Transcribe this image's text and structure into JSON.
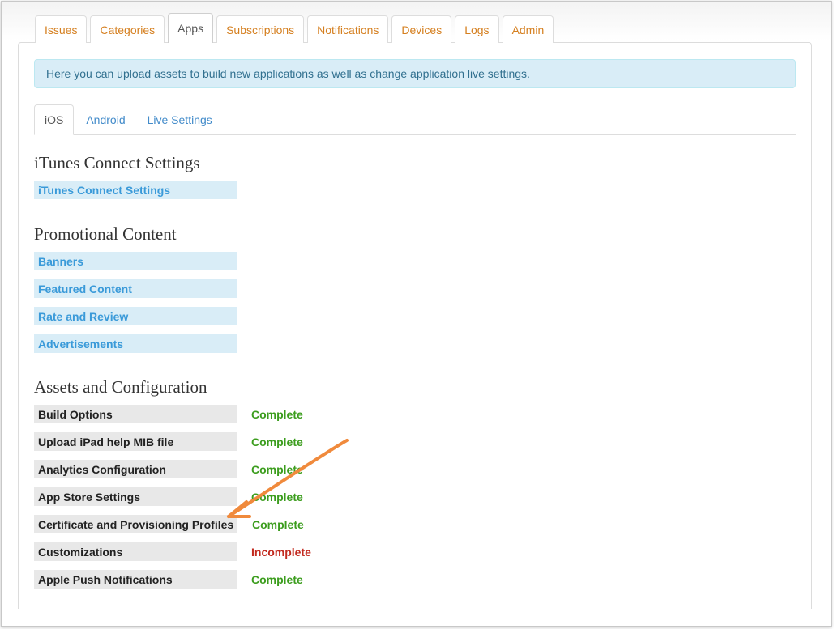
{
  "main_tabs": [
    {
      "label": "Issues",
      "active": false
    },
    {
      "label": "Categories",
      "active": false
    },
    {
      "label": "Apps",
      "active": true
    },
    {
      "label": "Subscriptions",
      "active": false
    },
    {
      "label": "Notifications",
      "active": false
    },
    {
      "label": "Devices",
      "active": false
    },
    {
      "label": "Logs",
      "active": false
    },
    {
      "label": "Admin",
      "active": false
    }
  ],
  "alert": {
    "text": "Here you can upload assets to build new applications as well as change application live settings."
  },
  "sub_tabs": [
    {
      "label": "iOS",
      "active": true
    },
    {
      "label": "Android",
      "active": false
    },
    {
      "label": "Live Settings",
      "active": false
    }
  ],
  "itunes": {
    "heading": "iTunes Connect Settings",
    "items": [
      {
        "label": "iTunes Connect Settings"
      }
    ]
  },
  "promo": {
    "heading": "Promotional Content",
    "items": [
      {
        "label": "Banners"
      },
      {
        "label": "Featured Content"
      },
      {
        "label": "Rate and Review"
      },
      {
        "label": "Advertisements"
      }
    ]
  },
  "assets": {
    "heading": "Assets and Configuration",
    "items": [
      {
        "label": "Build Options",
        "status": "Complete"
      },
      {
        "label": "Upload iPad help MIB file",
        "status": "Complete"
      },
      {
        "label": "Analytics Configuration",
        "status": "Complete"
      },
      {
        "label": "App Store Settings",
        "status": "Complete"
      },
      {
        "label": "Certificate and Provisioning Profiles",
        "status": "Complete"
      },
      {
        "label": "Customizations",
        "status": "Incomplete"
      },
      {
        "label": "Apple Push Notifications",
        "status": "Complete"
      }
    ]
  },
  "colors": {
    "tab_text": "#d57f1f",
    "link_blue": "#3a9ad9",
    "complete_green": "#3c9d1e",
    "incomplete_red": "#c22a1f",
    "annotation_arrow": "#f08a3c"
  },
  "annotation": {
    "icon": "orange-arrow-icon"
  }
}
